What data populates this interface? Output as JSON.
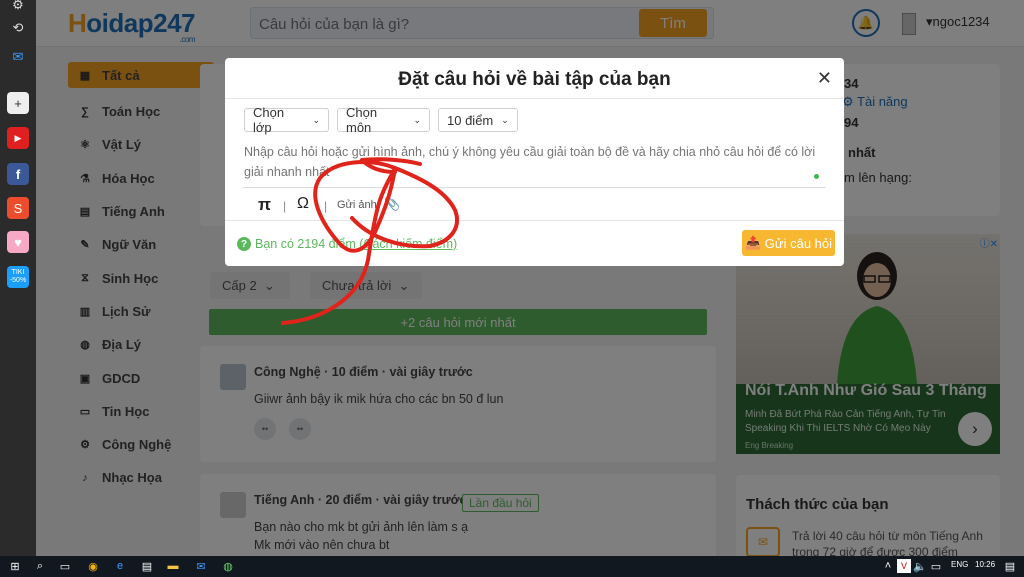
{
  "site": {
    "logo_text": "Hoidap247",
    "logo_suffix": ".com",
    "search_placeholder": "Câu hỏi của bạn là gì?",
    "search_button": "Tìm",
    "username": "ngoc1234"
  },
  "nav": {
    "items": [
      {
        "label": "Tất cả",
        "icon": "grid-icon"
      },
      {
        "label": "Toán Học",
        "icon": "math-icon"
      },
      {
        "label": "Vật Lý",
        "icon": "atom-icon"
      },
      {
        "label": "Hóa Học",
        "icon": "flask-icon"
      },
      {
        "label": "Tiếng Anh",
        "icon": "book-icon"
      },
      {
        "label": "Ngữ Văn",
        "icon": "pen-icon"
      },
      {
        "label": "Sinh Học",
        "icon": "dna-icon"
      },
      {
        "label": "Lịch Sử",
        "icon": "scroll-icon"
      },
      {
        "label": "Địa Lý",
        "icon": "globe-icon"
      },
      {
        "label": "GDCD",
        "icon": "civics-icon"
      },
      {
        "label": "Tin Học",
        "icon": "computer-icon"
      },
      {
        "label": "Công Nghệ",
        "icon": "gear-icon"
      },
      {
        "label": "Nhạc Họa",
        "icon": "music-icon"
      }
    ]
  },
  "filters": {
    "grade": "Cấp 2",
    "status": "Chưa trả lời",
    "new_questions": "+2 câu hỏi mới nhất"
  },
  "questions": [
    {
      "subject": "Công Nghệ",
      "points": "10 điểm",
      "time": "vài giây trước",
      "text": "Giiwr ảnh bậy ik mik hứa cho các bn 50 đ lun",
      "text2": ""
    },
    {
      "subject": "Tiếng Anh",
      "points": "20 điểm",
      "time": "vài giây trước",
      "text": "Bạn nào cho mk bt gửi ảnh lên làm s ạ",
      "text2": "Mk mới vào nên chưa bt",
      "badge": "Lần đầu hỏi"
    }
  ],
  "right": {
    "stat1": "34",
    "talent": "Tài năng",
    "stat2": "94",
    "rank_title": "nhất",
    "rank_sub": "m lên hạng:",
    "ad": {
      "headline": "Nói T.Anh Như Gió Sau 3 Tháng",
      "sub1": "Minh Đã Bứt Phá Rào Cản Tiếng Anh, Tự Tin",
      "sub2": "Speaking Khi Thi IELTS Nhờ Có Mẹo Này",
      "brand": "Eng Breaking"
    },
    "challenge_title": "Thách thức của bạn",
    "challenge_line1": "Trả lời 40 câu hỏi  từ môn Tiếng Anh",
    "challenge_line2": "trong 72 giờ để được 300 điểm"
  },
  "modal": {
    "title": "Đặt câu hỏi về bài tập của bạn",
    "grade_select": "Chọn lớp",
    "subject_select": "Chọn môn",
    "points_select": "10 điểm",
    "question_placeholder": "Nhập câu hỏi hoặc gửi hình ảnh, chú ý không yêu cầu giải toàn bộ đề và hãy chia nhỏ câu hỏi để có lời giải nhanh nhất",
    "pi_symbol": "π",
    "omega_symbol": "Ω",
    "send_image": "Gửi ảnh:",
    "points_prefix": "Bạn có 2194 điểm",
    "points_link": "(Cách kiếm điểm)",
    "submit": "Gửi câu hỏi"
  },
  "taskbar": {
    "lang": "ENG",
    "time": "10:26"
  },
  "colors": {
    "brand_blue": "#1e70b8",
    "brand_orange": "#f7a325",
    "green": "#5cb85c",
    "annotation_red": "#e0241b"
  }
}
